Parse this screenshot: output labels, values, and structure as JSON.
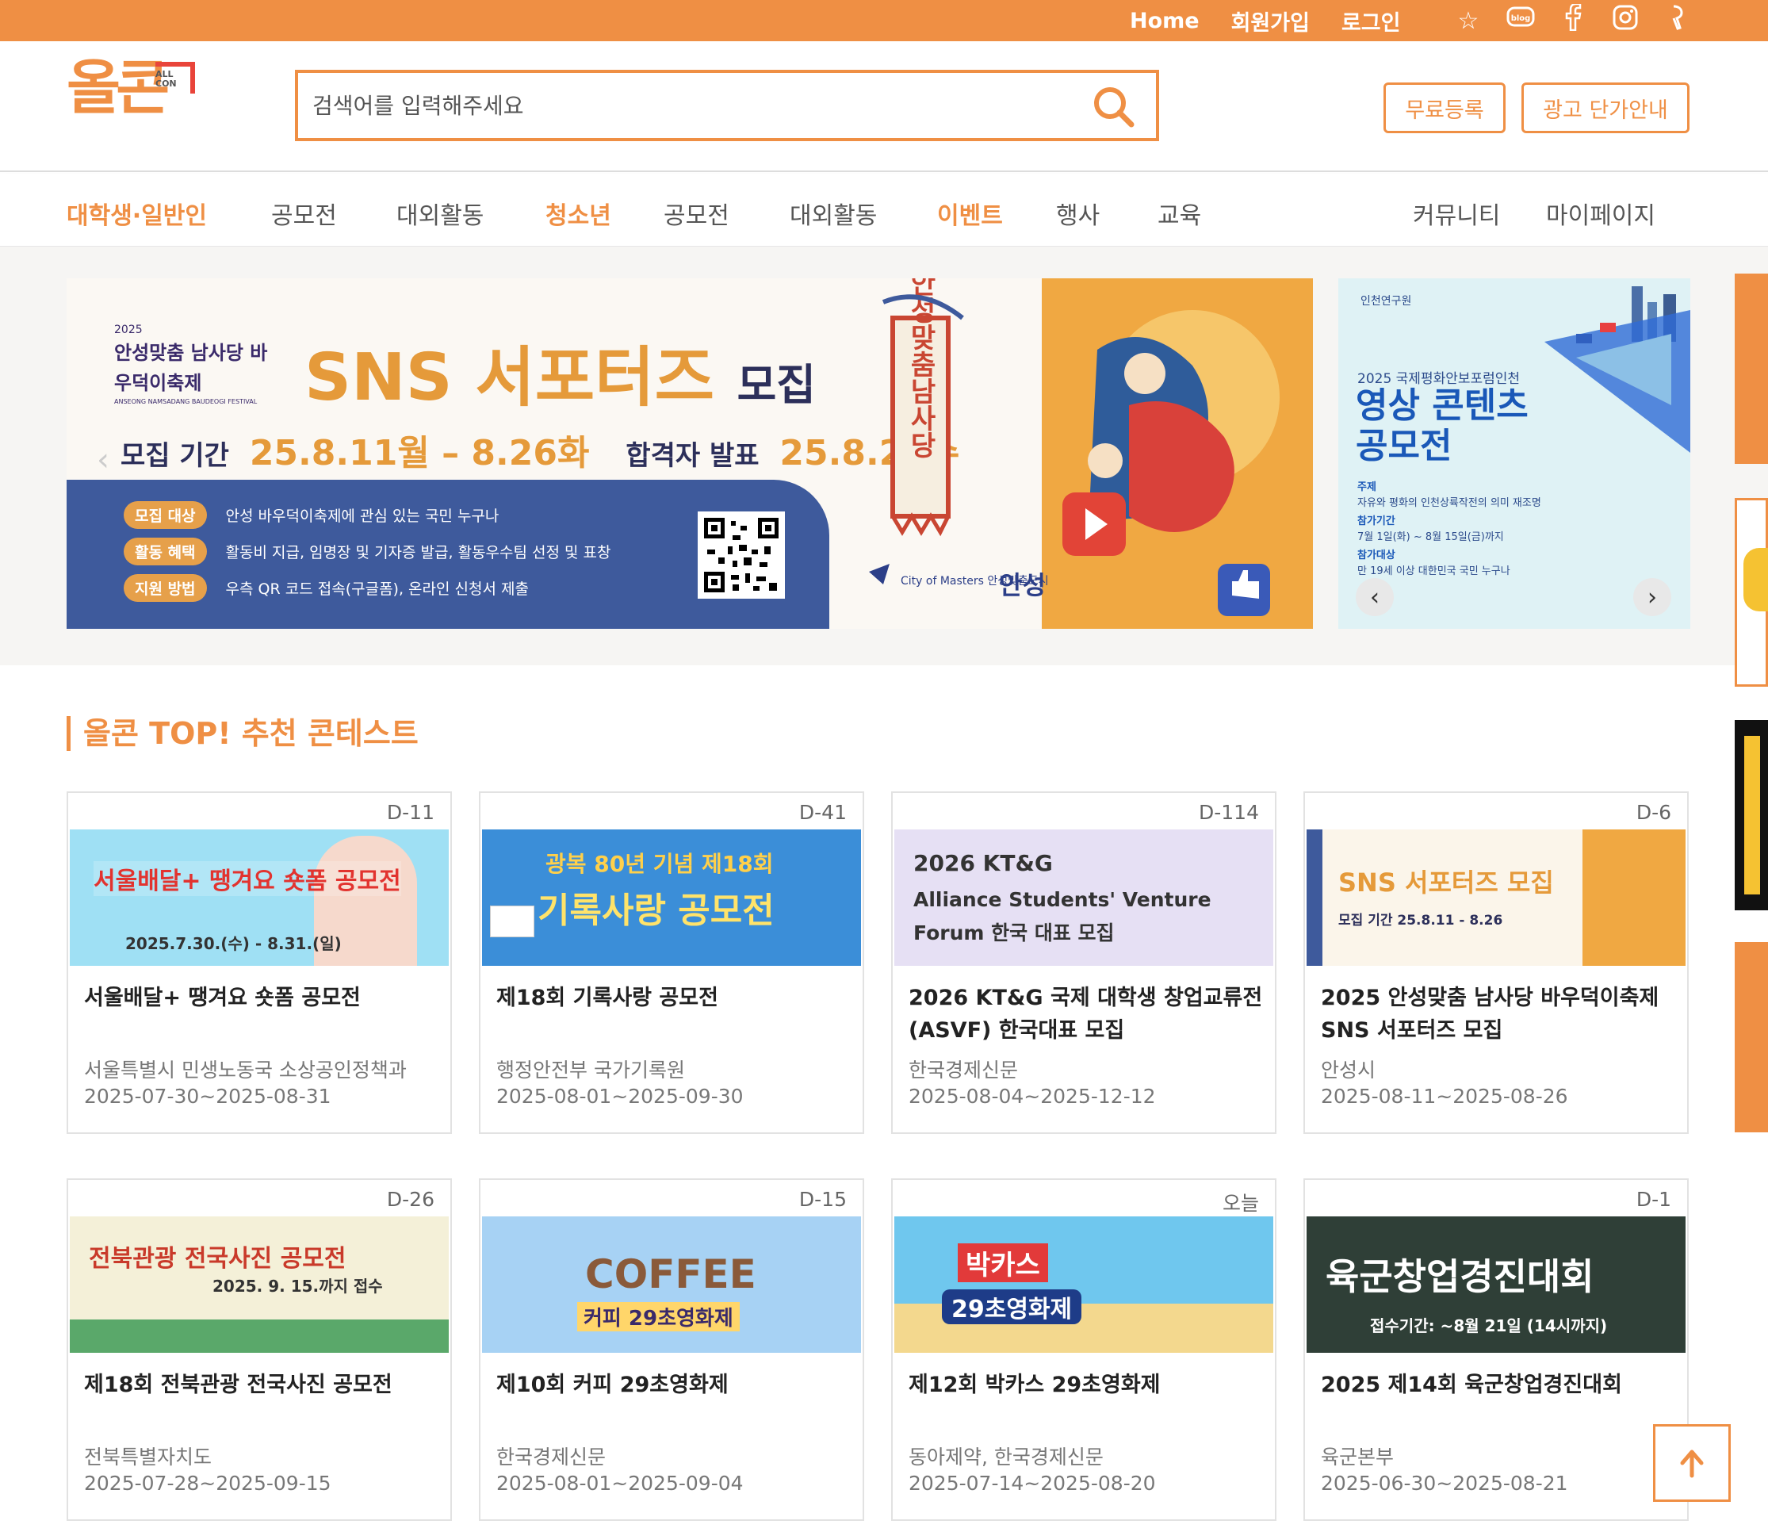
{
  "topbar": {
    "links": [
      "Home",
      "회원가입",
      "로그인"
    ],
    "icons": [
      "star-icon",
      "blog-icon",
      "facebook-icon",
      "instagram-icon",
      "kakao-icon"
    ]
  },
  "header": {
    "logo_text": "올콘",
    "logo_badge": "ALL CON",
    "search_placeholder": "검색어를 입력해주세요",
    "buttons": [
      "무료등록",
      "광고 단가안내"
    ]
  },
  "nav": {
    "items": [
      {
        "label": "대학생·일반인",
        "category": true
      },
      {
        "label": "공모전",
        "category": false
      },
      {
        "label": "대외활동",
        "category": false
      },
      {
        "label": "청소년",
        "category": true
      },
      {
        "label": "공모전",
        "category": false
      },
      {
        "label": "대외활동",
        "category": false
      },
      {
        "label": "이벤트",
        "category": true
      },
      {
        "label": "행사",
        "category": false
      },
      {
        "label": "교육",
        "category": false
      }
    ],
    "right_items": [
      "커뮤니티",
      "마이페이지"
    ]
  },
  "banner_main": {
    "year": "2025",
    "festival": "안성맞춤 남사당 바우덕이축제",
    "festival_en": "ANSEONG NAMSADANG BAUDEOGI FESTIVAL",
    "title": "SNS 서포터즈",
    "title_suffix": "모집",
    "period_label": "모집 기간",
    "period_value": "25.8.11월 – 8.26화",
    "announce_label": "합격자 발표",
    "announce_value": "25.8.27수",
    "rows": [
      {
        "tag": "모집 대상",
        "text": "안성 바우덕이축제에 관심 있는 국민 누구나"
      },
      {
        "tag": "활동 혜택",
        "text": "활동비 지급, 임명장 및 기자증 발급, 활동우수팀 선정 및 표창"
      },
      {
        "tag": "지원 방법",
        "text": "우측 QR 코드 접속(구글폼), 온라인 신청서 제출"
      }
    ],
    "flag_text": "안성맞춤남사당",
    "city_text": "City of Masters 안성맞춤도시",
    "city_name": "안성"
  },
  "banner_side": {
    "org": "인천연구원",
    "subtitle": "2025 국제평화안보포럼인천",
    "title_line1": "영상 콘텐츠",
    "title_line2": "공모전",
    "theme_label": "주제",
    "theme_text": "자유와 평화의 인천상륙작전의 의미 재조명",
    "period_label": "참가기간",
    "period_text": "7월 1일(화) ~ 8월 15일(금)까지",
    "target_label": "참가대상",
    "target_text": "만 19세 이상 대한민국 국민 누구나"
  },
  "section": {
    "title": "올콘 TOP! 추천 콘테스트"
  },
  "cards": [
    {
      "dday": "D-11",
      "title": "서울배달+ 땡겨요 숏폼 공모전",
      "org": "서울특별시 민생노동국 소상공인정책과",
      "date": "2025-07-30~2025-08-31",
      "thumb_text": "서울배달+ 땡겨요 숏폼 공모전",
      "thumb_sub": "2025.7.30.(수) - 8.31.(일)"
    },
    {
      "dday": "D-41",
      "title": "제18회 기록사랑 공모전",
      "org": "행정안전부 국가기록원",
      "date": "2025-08-01~2025-09-30",
      "thumb_text": "기록사랑 공모전",
      "thumb_sub": "광복 80년 기념 제18회"
    },
    {
      "dday": "D-114",
      "title": "2026 KT&G 국제 대학생 창업교류전 (ASVF) 한국대표 모집",
      "org": "한국경제신문",
      "date": "2025-08-04~2025-12-12",
      "thumb_text": "Alliance Students' Venture Forum 한국 대표 모집",
      "thumb_sub": "2026 KT&G"
    },
    {
      "dday": "D-6",
      "title": "2025 안성맞춤 남사당 바우덕이축제 SNS 서포터즈 모집",
      "org": "안성시",
      "date": "2025-08-11~2025-08-26",
      "thumb_text": "SNS 서포터즈 모집",
      "thumb_sub": "모집 기간 25.8.11 - 8.26"
    },
    {
      "dday": "D-26",
      "title": "제18회 전북관광 전국사진 공모전",
      "org": "전북특별자치도",
      "date": "2025-07-28~2025-09-15",
      "thumb_text": "전북관광 전국사진 공모전",
      "thumb_sub": "2025. 9. 15.까지 접수"
    },
    {
      "dday": "D-15",
      "title": "제10회 커피 29초영화제",
      "org": "한국경제신문",
      "date": "2025-08-01~2025-09-04",
      "thumb_text": "COFFEE",
      "thumb_sub": "커피 29초영화제"
    },
    {
      "dday": "오늘",
      "title": "제12회 박카스 29초영화제",
      "org": "동아제약, 한국경제신문",
      "date": "2025-07-14~2025-08-20",
      "thumb_text": "박카스",
      "thumb_sub": "29초영화제"
    },
    {
      "dday": "D-1",
      "title": "2025 제14회 육군창업경진대회",
      "org": "육군본부",
      "date": "2025-06-30~2025-08-21",
      "thumb_text": "육군창업경진대회",
      "thumb_sub": "접수기간: ~8월 21일 (14시까지)"
    }
  ],
  "colors": {
    "accent": "#ef8f44",
    "navy": "#3e5a9c"
  }
}
